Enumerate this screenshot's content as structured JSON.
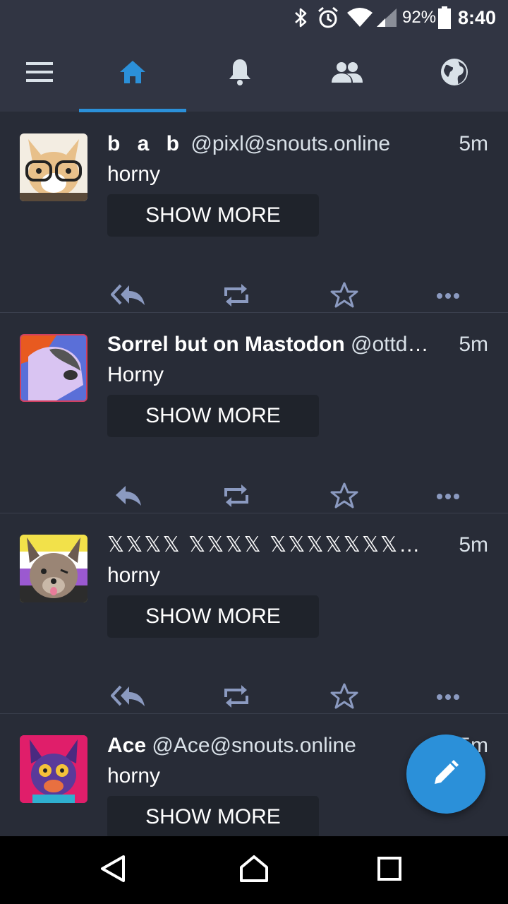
{
  "status_bar": {
    "battery_percent": "92%",
    "time": "8:40",
    "icons": [
      "bluetooth-icon",
      "alarm-icon",
      "wifi-icon",
      "signal-icon",
      "battery-icon"
    ]
  },
  "tabs": [
    {
      "name": "menu",
      "icon": "menu-icon",
      "active": false
    },
    {
      "name": "home",
      "icon": "home-icon",
      "active": true
    },
    {
      "name": "notifications",
      "icon": "bell-icon",
      "active": false
    },
    {
      "name": "local",
      "icon": "people-icon",
      "active": false
    },
    {
      "name": "federated",
      "icon": "globe-icon",
      "active": false
    }
  ],
  "colors": {
    "accent": "#2b90d9",
    "background": "#282c37",
    "bar": "#313543",
    "action_icon": "#8b9ac0",
    "button_bg": "#1f232b"
  },
  "feed": {
    "show_more_label": "SHOW MORE",
    "statuses": [
      {
        "display_name": "b a b",
        "acct": "@pixl@snouts.online",
        "time": "5m",
        "content": "horny",
        "reply_icon": "reply-all-icon"
      },
      {
        "display_name": "Sorrel but on Mastodon",
        "acct": "@ottdo…",
        "time": "5m",
        "content": "Horny",
        "reply_icon": "reply-icon"
      },
      {
        "display_name": "𝕏𝕏𝕏𝕏 𝕏𝕏𝕏𝕏 𝕏𝕏𝕏𝕏𝕏𝕏𝕏𝕏𝕏𝕏 t h e 𝕏𝕏𝕏𝕏",
        "acct": "@…",
        "time": "5m",
        "content": "horny",
        "reply_icon": "reply-all-icon"
      },
      {
        "display_name": "Ace",
        "acct": "@Ace@snouts.online",
        "time": "5m",
        "content": "horny",
        "reply_icon": "reply-icon"
      }
    ]
  },
  "fab": {
    "icon": "pencil-icon"
  },
  "nav_bar": {
    "buttons": [
      "back-icon",
      "home-icon",
      "recents-icon"
    ]
  }
}
